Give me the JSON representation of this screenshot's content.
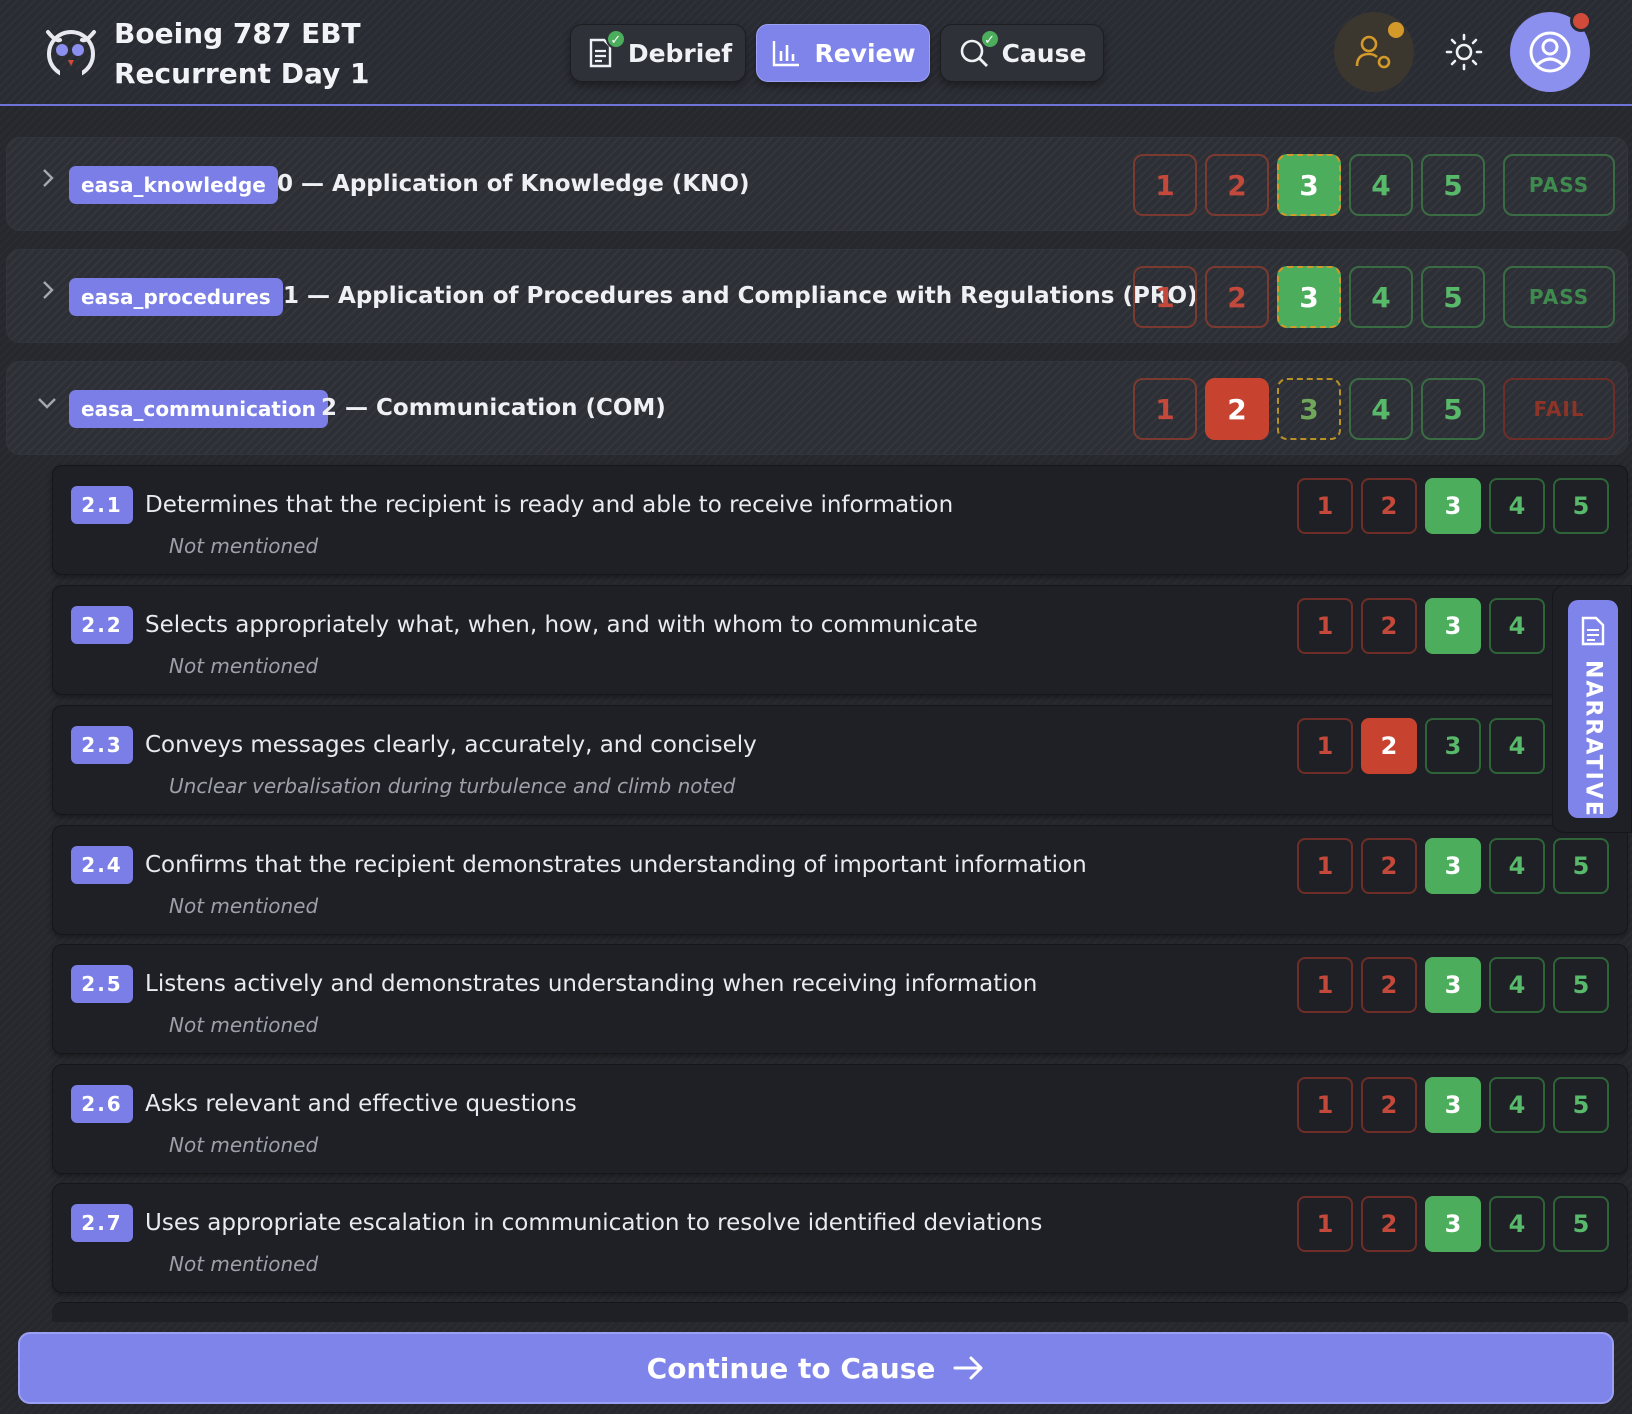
{
  "app": {
    "title": "Boeing 787 EBT\nRecurrent Day 1"
  },
  "tabs": [
    {
      "label": "Debrief",
      "icon": "document-icon",
      "done": true
    },
    {
      "label": "Review",
      "icon": "bar-chart-icon",
      "active": true
    },
    {
      "label": "Cause",
      "icon": "search-icon",
      "done": true
    }
  ],
  "colors": {
    "accent": "#7f84ea",
    "pass": "#4cad5c",
    "fail": "#c7432f",
    "warning": "#d39a2a"
  },
  "competencies": [
    {
      "tag": "easa_knowledge",
      "title": "0 — Application of Knowledge (KNO)",
      "grades": [
        "1",
        "2",
        "3",
        "4",
        "5"
      ],
      "selected": 3,
      "verdict": "PASS",
      "expanded": false
    },
    {
      "tag": "easa_procedures",
      "title": "1 — Application of Procedures and Compliance with Regulations (PRO)",
      "grades": [
        "1",
        "2",
        "3",
        "4",
        "5"
      ],
      "selected": 3,
      "verdict": "PASS",
      "expanded": false
    },
    {
      "tag": "easa_communication",
      "title": "2 — Communication (COM)",
      "grades": [
        "1",
        "2",
        "3",
        "4",
        "5"
      ],
      "selected": 2,
      "verdict": "FAIL",
      "expanded": true
    }
  ],
  "behaviours": [
    {
      "num": "2.1",
      "text": "Determines that the recipient is ready and able to receive information",
      "note": "Not mentioned",
      "selected": 3
    },
    {
      "num": "2.2",
      "text": "Selects appropriately what, when, how, and with whom to communicate",
      "note": "Not mentioned",
      "selected": 3
    },
    {
      "num": "2.3",
      "text": "Conveys messages clearly, accurately, and concisely",
      "note": "Unclear verbalisation during turbulence and climb noted",
      "selected": 2
    },
    {
      "num": "2.4",
      "text": "Confirms that the recipient demonstrates understanding of important information",
      "note": "Not mentioned",
      "selected": 3
    },
    {
      "num": "2.5",
      "text": "Listens actively and demonstrates understanding when receiving information",
      "note": "Not mentioned",
      "selected": 3
    },
    {
      "num": "2.6",
      "text": "Asks relevant and effective questions",
      "note": "Not mentioned",
      "selected": 3
    },
    {
      "num": "2.7",
      "text": "Uses appropriate escalation in communication to resolve identified deviations",
      "note": "Not mentioned",
      "selected": 3
    }
  ],
  "scale": [
    "1",
    "2",
    "3",
    "4",
    "5"
  ],
  "narrative": {
    "label": "NARRATIVE"
  },
  "footer": {
    "continue_label": "Continue to Cause"
  }
}
